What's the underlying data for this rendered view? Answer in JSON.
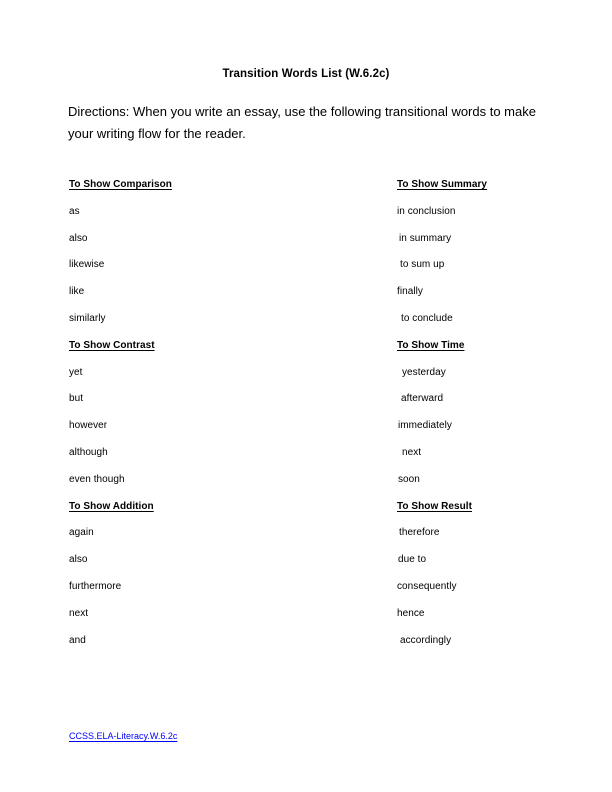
{
  "document": {
    "title": "Transition Words List (W.6.2c)",
    "directions": "Directions: When you write an essay, use the following transitional words to make your writing flow for the reader.",
    "standard_link": "CCSS.ELA-Literacy.W.6.2c",
    "link_color": "#0000ff"
  },
  "columns": {
    "left": [
      {
        "heading": "To Show Comparison",
        "items": [
          "as",
          "also",
          "likewise",
          "like",
          "similarly"
        ]
      },
      {
        "heading": "To Show Contrast",
        "items": [
          "yet",
          "but",
          "however",
          "although",
          "even though"
        ]
      },
      {
        "heading": "To Show Addition",
        "items": [
          "again",
          "also",
          "furthermore",
          "next",
          "and"
        ]
      }
    ],
    "right": [
      {
        "heading": "To Show Summary",
        "items": [
          "in conclusion",
          "in summary",
          "to sum up",
          "finally",
          "to conclude"
        ]
      },
      {
        "heading": "To Show Time",
        "items": [
          "yesterday",
          "afterward",
          "immediately",
          "next",
          "soon"
        ]
      },
      {
        "heading": "To Show Result",
        "items": [
          "therefore",
          "due to",
          "consequently",
          "hence",
          "accordingly"
        ]
      }
    ]
  }
}
